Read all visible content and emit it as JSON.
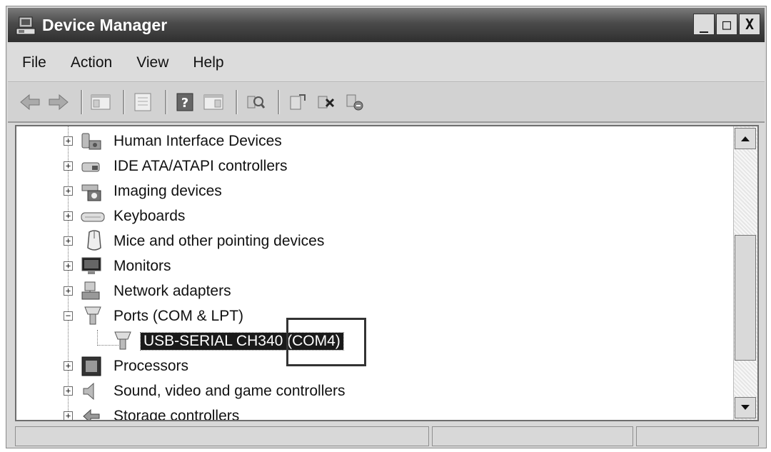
{
  "window": {
    "title": "Device Manager",
    "controls": {
      "minimize": "_",
      "maximize": "□",
      "close": "X"
    }
  },
  "menu": [
    "File",
    "Action",
    "View",
    "Help"
  ],
  "toolbar": {
    "buttons": [
      "back-icon",
      "forward-icon",
      "show-hide-console-tree-icon",
      "properties-icon",
      "help-icon",
      "show-hide-action-pane-icon",
      "scan-hardware-icon",
      "update-driver-icon",
      "disable-device-icon",
      "uninstall-device-icon"
    ]
  },
  "tree": {
    "items": [
      {
        "label": "Human Interface Devices",
        "expander": "+",
        "icon": "hid-icon"
      },
      {
        "label": "IDE ATA/ATAPI controllers",
        "expander": "+",
        "icon": "ide-controller-icon"
      },
      {
        "label": "Imaging devices",
        "expander": "+",
        "icon": "imaging-device-icon"
      },
      {
        "label": "Keyboards",
        "expander": "+",
        "icon": "keyboard-icon"
      },
      {
        "label": "Mice and other pointing devices",
        "expander": "+",
        "icon": "mouse-icon"
      },
      {
        "label": "Monitors",
        "expander": "+",
        "icon": "monitor-icon"
      },
      {
        "label": "Network adapters",
        "expander": "+",
        "icon": "network-adapter-icon"
      },
      {
        "label": "Ports (COM & LPT)",
        "expander": "−",
        "icon": "port-icon"
      },
      {
        "label": "USB-SERIAL CH340 (COM4)",
        "child": true,
        "selected": true,
        "icon": "serial-port-icon"
      },
      {
        "label": "Processors",
        "expander": "+",
        "icon": "processor-icon"
      },
      {
        "label": "Sound, video and game controllers",
        "expander": "+",
        "icon": "sound-icon"
      },
      {
        "label": "Storage controllers",
        "expander": "+",
        "icon": "storage-controller-icon"
      }
    ]
  },
  "statusbar": {
    "panes": [
      "",
      "",
      ""
    ]
  }
}
